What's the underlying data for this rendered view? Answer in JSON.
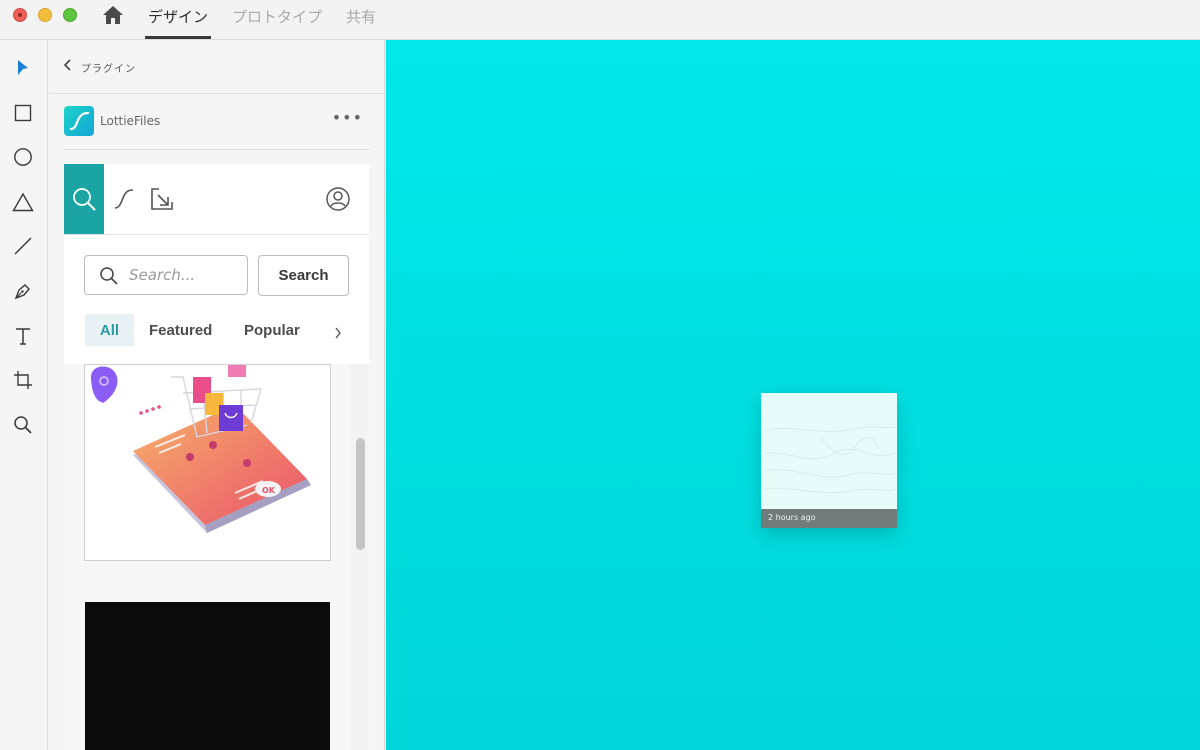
{
  "titlebar": {
    "tabs": [
      {
        "label": "デザイン",
        "active": true
      },
      {
        "label": "プロトタイプ",
        "active": false
      },
      {
        "label": "共有",
        "active": false
      }
    ]
  },
  "toolbar": {
    "tools": [
      "select-icon",
      "rectangle-icon",
      "ellipse-icon",
      "triangle-icon",
      "line-icon",
      "pen-icon",
      "text-icon",
      "artboard-icon",
      "zoom-icon"
    ]
  },
  "panel": {
    "title": "プラグイン",
    "plugin_name": "LottieFiles",
    "more_label": "•••"
  },
  "plugin_ui": {
    "search_placeholder": "Search...",
    "search_button": "Search",
    "filters": [
      "All",
      "Featured",
      "Popular"
    ],
    "filter_next": "›"
  },
  "canvas": {
    "artboard_time": "2 hours ago"
  },
  "colors": {
    "accent": "#1ba4a4",
    "canvas_bg": "#00e4e6"
  }
}
